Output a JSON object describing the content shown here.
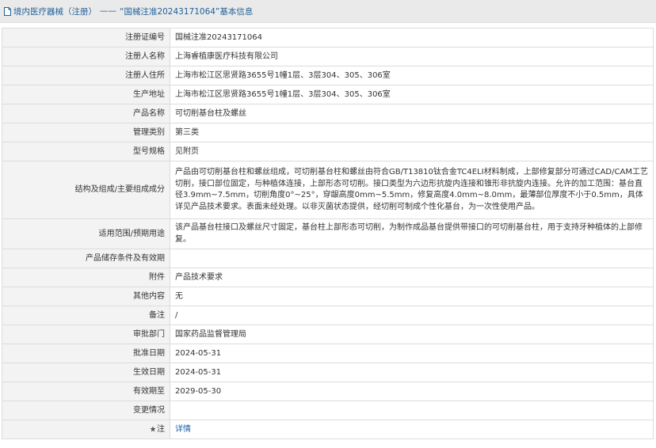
{
  "header": {
    "crumb_first": "境内医疗器械（注册）",
    "separator": "——",
    "crumb_second": "“国械注准20243171064”基本信息"
  },
  "rows": [
    {
      "label": "注册证编号",
      "value": "国械注准20243171064"
    },
    {
      "label": "注册人名称",
      "value": "上海睿植康医疗科技有限公司"
    },
    {
      "label": "注册人住所",
      "value": "上海市松江区思贤路3655号1幢1层、3层304、305、306室"
    },
    {
      "label": "生产地址",
      "value": "上海市松江区思贤路3655号1幢1层、3层304、305、306室"
    },
    {
      "label": "产品名称",
      "value": "可切削基台柱及螺丝"
    },
    {
      "label": "管理类别",
      "value": "第三类"
    },
    {
      "label": "型号规格",
      "value": "见附页"
    },
    {
      "label": "结构及组成/主要组成成分",
      "value": "产品由可切削基台柱和螺丝组成，可切削基台柱和螺丝由符合GB/T13810钛合金TC4ELI材料制成，上部修复部分可通过CAD/CAM工艺切削，接口部位固定，与种植体连接，上部形态可切削。接口类型为六边形抗旋内连接和锥形非抗旋内连接。允许的加工范围：基台直径3.9mm~7.5mm，切削角度0°~25°，穿龈高度0mm~5.5mm，修复高度4.0mm~8.0mm，最薄部位厚度不小于0.5mm，具体详见产品技术要求。表面未经处理。以非灭菌状态提供，经切削可制成个性化基台，为一次性使用产品。"
    },
    {
      "label": "适用范围/预期用途",
      "value": "该产品基台柱接口及螺丝尺寸固定，基台柱上部形态可切削，为制作成品基台提供带接口的可切削基台柱，用于支持牙种植体的上部修复。"
    },
    {
      "label": "产品储存条件及有效期",
      "value": ""
    },
    {
      "label": "附件",
      "value": "产品技术要求"
    },
    {
      "label": "其他内容",
      "value": "无"
    },
    {
      "label": "备注",
      "value": "/"
    },
    {
      "label": "审批部门",
      "value": "国家药品监督管理局"
    },
    {
      "label": "批准日期",
      "value": "2024-05-31"
    },
    {
      "label": "生效日期",
      "value": "2024-05-31"
    },
    {
      "label": "有效期至",
      "value": "2029-05-30"
    },
    {
      "label": "变更情况",
      "value": ""
    }
  ],
  "note": {
    "label": "注",
    "link": "详情",
    "icon": "star-icon"
  }
}
